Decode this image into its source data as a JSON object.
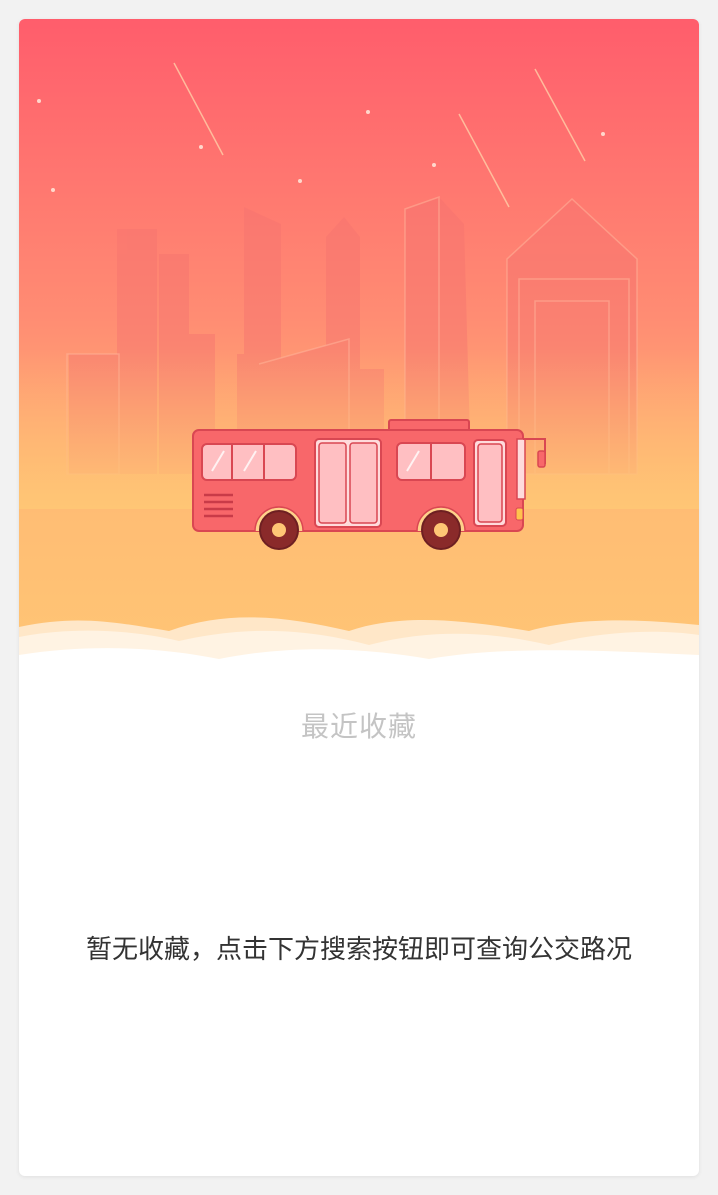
{
  "header": {
    "section_title": "最近收藏"
  },
  "empty_state": {
    "message": "暂无收藏，点击下方搜索按钮即可查询公交路况"
  },
  "theme": {
    "gradient_top": "#ff5d6c",
    "gradient_bottom": "#ffc675",
    "bus_body": "#f8676a",
    "wheel": "#8a2a2a"
  }
}
